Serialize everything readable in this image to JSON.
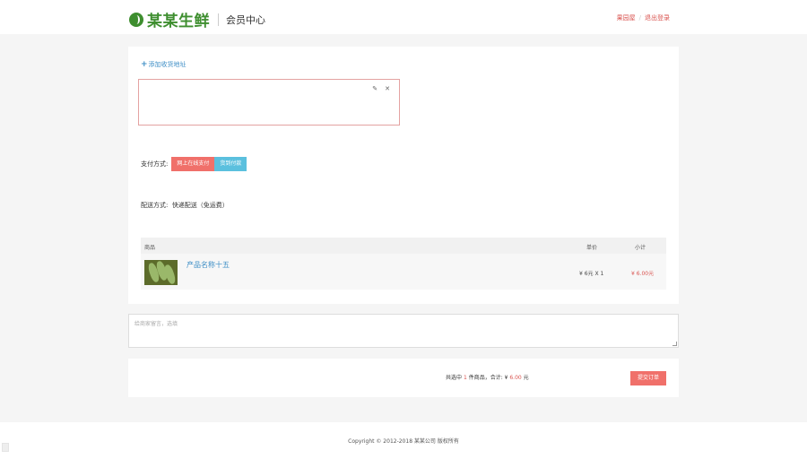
{
  "header": {
    "brand": "某某生鲜",
    "subtitle": "会员中心",
    "links": [
      "果园屋",
      "退出登录"
    ],
    "accent": "#3e8e2f"
  },
  "address": {
    "add_label": "添加收货地址",
    "add_icon": "plus-icon",
    "edit_icon": "edit-icon",
    "delete_icon": "close-icon"
  },
  "payment": {
    "label": "支付方式:",
    "options": [
      "网上在线支付",
      "货到付款"
    ],
    "selected": "网上在线支付"
  },
  "shipping": {
    "label": "配送方式:",
    "value": "快递配送（免运费）"
  },
  "table": {
    "headers": [
      "商品",
      "单价",
      "小计"
    ],
    "rows": [
      {
        "name": "产品名称十五",
        "unit_price": "¥ 6元 X 1",
        "subtotal": "¥ 6.00元"
      }
    ]
  },
  "message": {
    "placeholder": "给商家留言，选填"
  },
  "total": {
    "prefix": "共选中",
    "count": "1",
    "mid": "件商品，合计: ¥",
    "amount": "6.00",
    "suffix": "元",
    "submit_label": "提交订单"
  },
  "footer": {
    "copyright": "Copyright © 2012-2018 某某公司 版权所有"
  },
  "colors": {
    "red": "#d9534f",
    "blue": "#3f8fc6",
    "cyan": "#5bc0de",
    "green": "#3e8e2f"
  }
}
